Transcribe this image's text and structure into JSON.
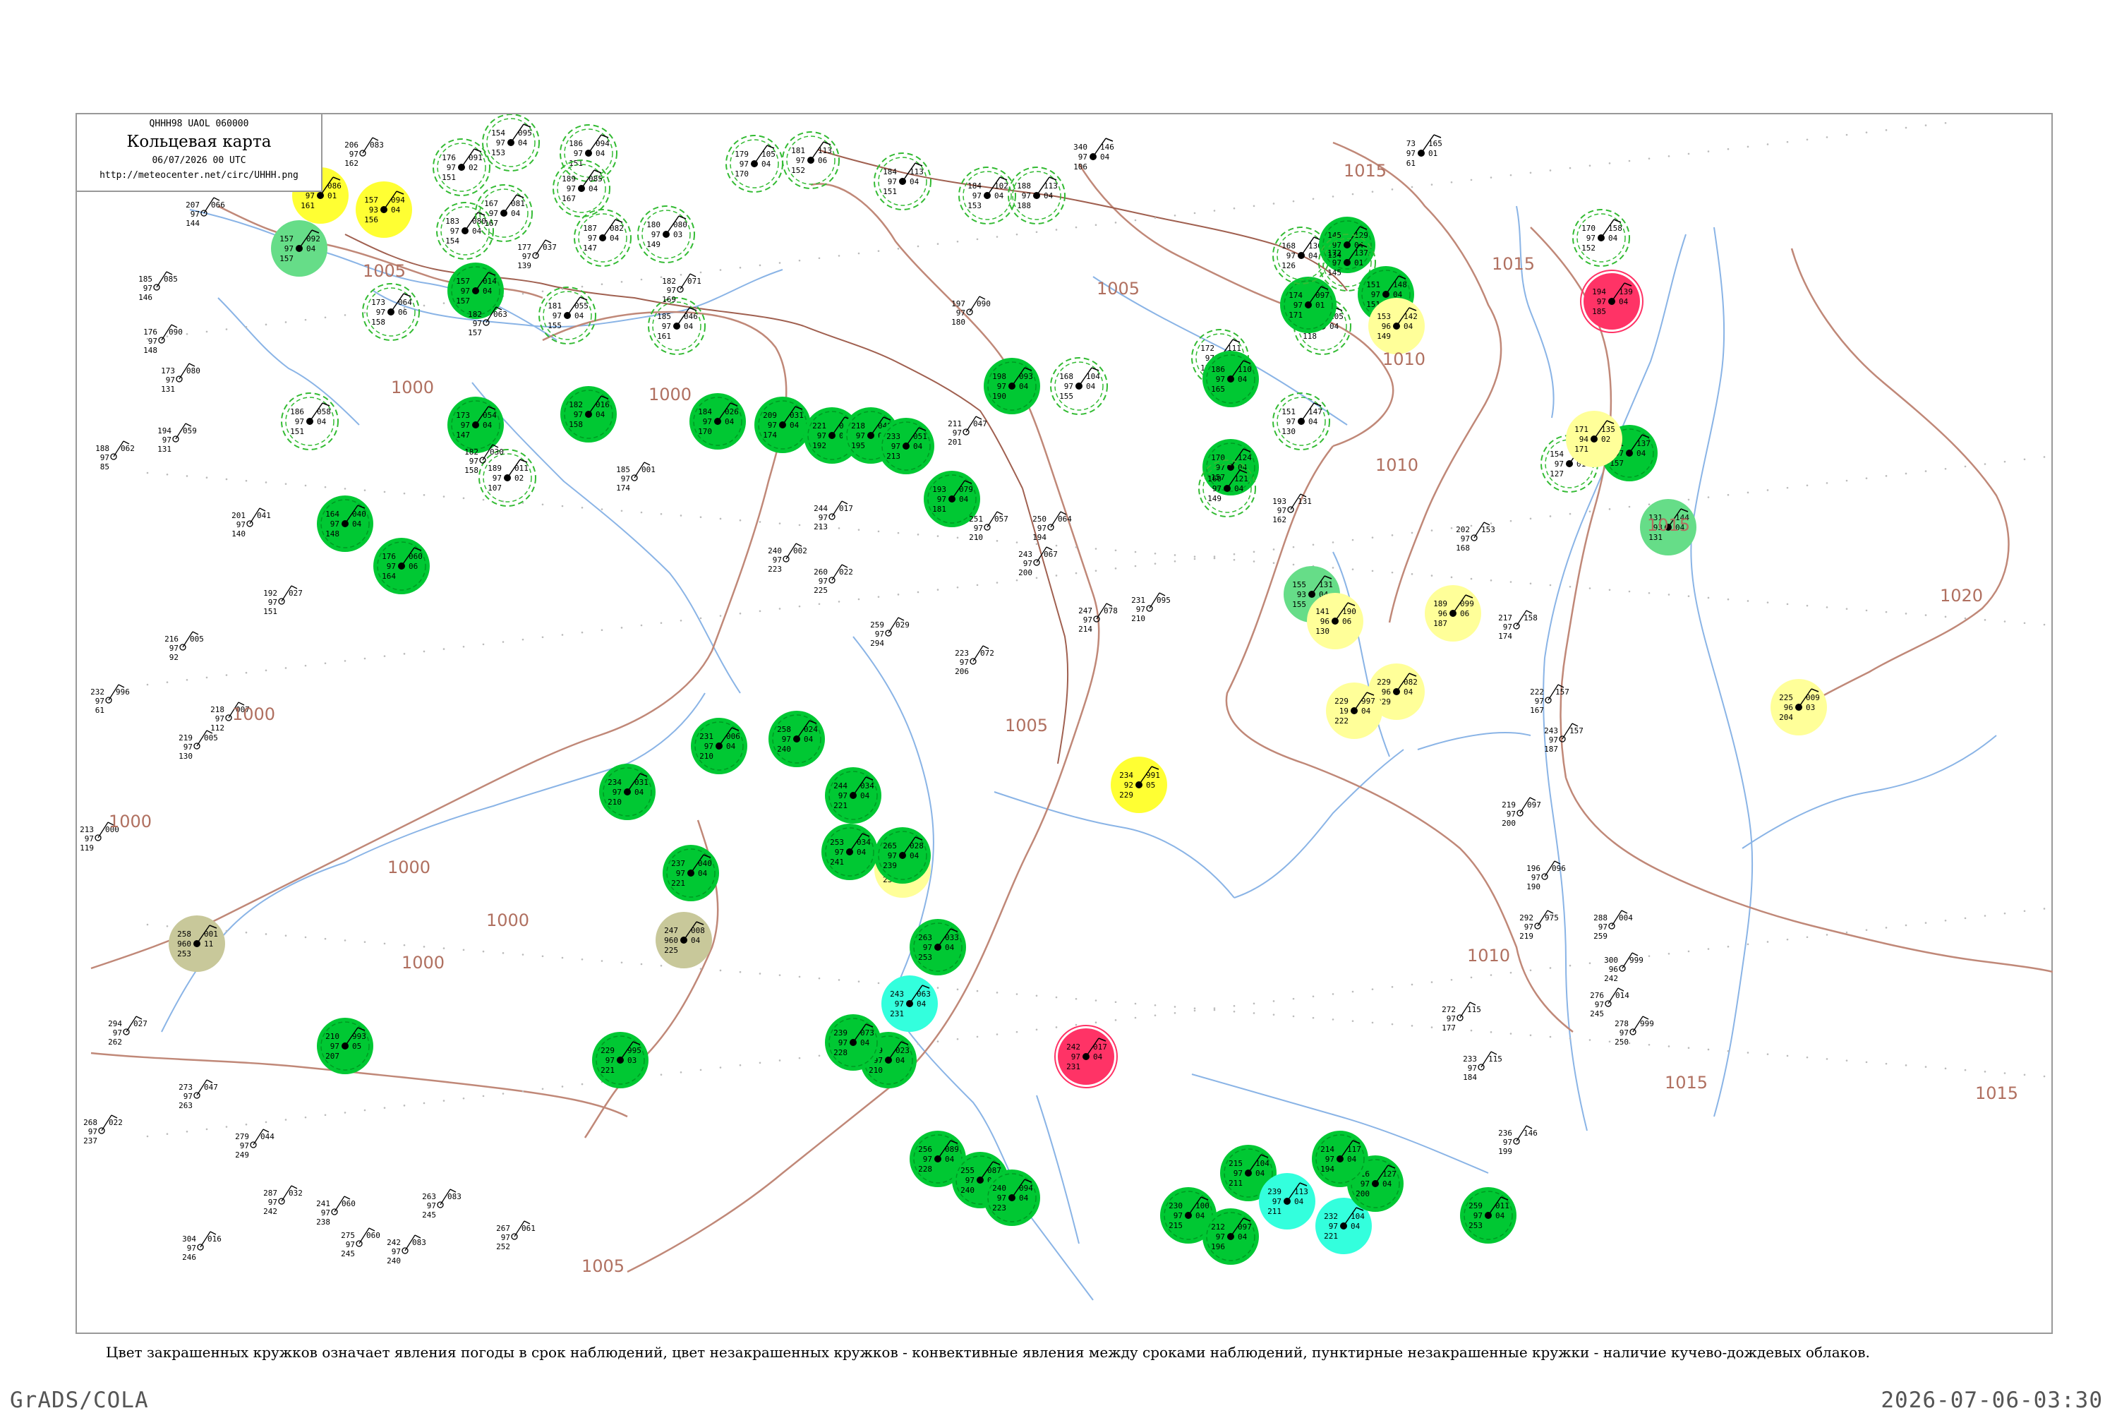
{
  "header": {
    "code_line": "QHHH98  UAOL  060000",
    "title": "Кольцевая карта",
    "datetime": "06/07/2026 00 UTC",
    "url": "http://meteocenter.net/circ/UHHH.png"
  },
  "legend_caption": "Цвет закрашенных кружков означает явления погоды в срок наблюдений, цвет незакрашенных кружков - конвективные явления между сроками наблюдений, пунктирные незакрашенные кружки - наличие кучево-дождевых облаков.",
  "footer": {
    "left": "GrADS/COLA",
    "right": "2026-07-06-03:30"
  },
  "colors": {
    "green": "#00c833",
    "light_green": "#66dd88",
    "yellow": "#ffff33",
    "pale_yellow": "#ffff99",
    "red": "#ff3366",
    "olive": "#c8c89a",
    "cyan": "#33ffdd",
    "dashed_ring": "#33bb33",
    "river": "#8ab4e6",
    "isobar": "#c08878",
    "border": "#a06050"
  },
  "isobar_labels": [
    "1000",
    "1005",
    "1010",
    "1015",
    "1020"
  ],
  "stations": [
    {
      "p": "161",
      "dp": "086",
      "t": "97",
      "v": "01",
      "tail": "161",
      "idx": "",
      "fill": "yellow"
    },
    {
      "p": "157",
      "dp": "094",
      "t": "93",
      "v": "04",
      "tail": "156",
      "idx": "",
      "fill": "yellow"
    },
    {
      "p": "157",
      "dp": "092",
      "t": "97",
      "v": "04",
      "tail": "157",
      "idx": "",
      "fill": "light_green"
    },
    {
      "p": "154",
      "dp": "095",
      "t": "97",
      "v": "04",
      "tail": "153",
      "idx": "",
      "fill": "ring"
    },
    {
      "p": "176",
      "dp": "091",
      "t": "97",
      "v": "02",
      "tail": "151",
      "idx": "",
      "fill": "ring"
    },
    {
      "p": "186",
      "dp": "094",
      "t": "97",
      "v": "04",
      "tail": "151",
      "idx": "",
      "fill": "ring"
    },
    {
      "p": "179",
      "dp": "105",
      "t": "97",
      "v": "04",
      "tail": "170",
      "idx": "",
      "fill": "ring"
    },
    {
      "p": "181",
      "dp": "113",
      "t": "97",
      "v": "06",
      "tail": "152",
      "idx": "",
      "fill": "ring"
    },
    {
      "p": "184",
      "dp": "113",
      "t": "97",
      "v": "04",
      "tail": "151",
      "idx": "",
      "fill": "ring"
    },
    {
      "p": "184",
      "dp": "102",
      "t": "97",
      "v": "04",
      "tail": "153",
      "idx": "",
      "fill": "ring"
    },
    {
      "p": "188",
      "dp": "113",
      "t": "97",
      "v": "04",
      "tail": "188",
      "idx": "",
      "fill": "ring"
    },
    {
      "p": "340",
      "dp": "146",
      "t": "97",
      "v": "04",
      "tail": "106",
      "idx": "",
      "fill": "none"
    },
    {
      "p": "73",
      "dp": "165",
      "t": "97",
      "v": "01",
      "tail": "61",
      "idx": "",
      "fill": "none"
    },
    {
      "p": "173",
      "dp": "064",
      "t": "97",
      "v": "06",
      "tail": "158",
      "idx": "",
      "fill": "ring"
    },
    {
      "p": "157",
      "dp": "014",
      "t": "97",
      "v": "04",
      "tail": "157",
      "idx": "",
      "fill": "green"
    },
    {
      "p": "183",
      "dp": "080",
      "t": "97",
      "v": "04",
      "tail": "154",
      "idx": "",
      "fill": "ring"
    },
    {
      "p": "189",
      "dp": "085",
      "t": "97",
      "v": "04",
      "tail": "167",
      "idx": "",
      "fill": "ring"
    },
    {
      "p": "167",
      "dp": "081",
      "t": "97",
      "v": "04",
      "tail": "167",
      "idx": "",
      "fill": "ring"
    },
    {
      "p": "187",
      "dp": "082",
      "t": "97",
      "v": "04",
      "tail": "147",
      "idx": "",
      "fill": "ring"
    },
    {
      "p": "180",
      "dp": "080",
      "t": "97",
      "v": "03",
      "tail": "149",
      "idx": "",
      "fill": "ring"
    },
    {
      "p": "185",
      "dp": "046",
      "t": "97",
      "v": "04",
      "tail": "161",
      "idx": "",
      "fill": "ring"
    },
    {
      "p": "181",
      "dp": "055",
      "t": "97",
      "v": "04",
      "tail": "155",
      "idx": "",
      "fill": "ring"
    },
    {
      "p": "186",
      "dp": "058",
      "t": "97",
      "v": "04",
      "tail": "151",
      "idx": "",
      "fill": "ring"
    },
    {
      "p": "173",
      "dp": "054",
      "t": "97",
      "v": "04",
      "tail": "147",
      "idx": "",
      "fill": "green"
    },
    {
      "p": "189",
      "dp": "011",
      "t": "97",
      "v": "02",
      "tail": "107",
      "idx": "",
      "fill": "ring"
    },
    {
      "p": "164",
      "dp": "040",
      "t": "97",
      "v": "04",
      "tail": "148",
      "idx": "",
      "fill": "green"
    },
    {
      "p": "176",
      "dp": "060",
      "t": "97",
      "v": "06",
      "tail": "164",
      "idx": "",
      "fill": "green"
    },
    {
      "p": "182",
      "dp": "016",
      "t": "97",
      "v": "04",
      "tail": "158",
      "idx": "",
      "fill": "green"
    },
    {
      "p": "184",
      "dp": "026",
      "t": "97",
      "v": "04",
      "tail": "170",
      "idx": "",
      "fill": "green"
    },
    {
      "p": "209",
      "dp": "031",
      "t": "97",
      "v": "04",
      "tail": "174",
      "idx": "",
      "fill": "green"
    },
    {
      "p": "221",
      "dp": "040",
      "t": "97",
      "v": "04",
      "tail": "192",
      "idx": "",
      "fill": "green"
    },
    {
      "p": "218",
      "dp": "049",
      "t": "97",
      "v": "04",
      "tail": "195",
      "idx": "",
      "fill": "green"
    },
    {
      "p": "233",
      "dp": "051",
      "t": "97",
      "v": "04",
      "tail": "213",
      "idx": "",
      "fill": "green"
    },
    {
      "p": "193",
      "dp": "079",
      "t": "97",
      "v": "04",
      "tail": "181",
      "idx": "",
      "fill": "green"
    },
    {
      "p": "198",
      "dp": "093",
      "t": "97",
      "v": "04",
      "tail": "190",
      "idx": "",
      "fill": "green"
    },
    {
      "p": "168",
      "dp": "104",
      "t": "97",
      "v": "04",
      "tail": "155",
      "idx": "",
      "fill": "ring"
    },
    {
      "p": "172",
      "dp": "111",
      "t": "97",
      "v": "01",
      "tail": "152",
      "idx": "",
      "fill": "ring"
    },
    {
      "p": "186",
      "dp": "110",
      "t": "97",
      "v": "04",
      "tail": "165",
      "idx": "",
      "fill": "green"
    },
    {
      "p": "170",
      "dp": "124",
      "t": "97",
      "v": "04",
      "tail": "157",
      "idx": "",
      "fill": "green"
    },
    {
      "p": "160",
      "dp": "121",
      "t": "97",
      "v": "04",
      "tail": "149",
      "idx": "",
      "fill": "ring"
    },
    {
      "p": "151",
      "dp": "147",
      "t": "97",
      "v": "04",
      "tail": "130",
      "idx": "",
      "fill": "ring"
    },
    {
      "p": "124",
      "dp": "105",
      "t": "97",
      "v": "04",
      "tail": "118",
      "idx": "",
      "fill": "ring"
    },
    {
      "p": "174",
      "dp": "097",
      "t": "97",
      "v": "01",
      "tail": "171",
      "idx": "",
      "fill": "green"
    },
    {
      "p": "168",
      "dp": "130",
      "t": "97",
      "v": "04",
      "tail": "126",
      "idx": "",
      "fill": "ring"
    },
    {
      "p": "145",
      "dp": "129",
      "t": "97",
      "v": "04",
      "tail": "134",
      "idx": "",
      "fill": "green"
    },
    {
      "p": "172",
      "dp": "137",
      "t": "97",
      "v": "01",
      "tail": "145",
      "idx": "",
      "fill": "ring"
    },
    {
      "p": "151",
      "dp": "148",
      "t": "97",
      "v": "04",
      "tail": "151",
      "idx": "",
      "fill": "green"
    },
    {
      "p": "153",
      "dp": "142",
      "t": "96",
      "v": "04",
      "tail": "149",
      "idx": "",
      "fill": "pale_yellow"
    },
    {
      "p": "154",
      "dp": "160",
      "t": "97",
      "v": "01",
      "tail": "127",
      "idx": "",
      "fill": "ring"
    },
    {
      "p": "170",
      "dp": "158",
      "t": "97",
      "v": "04",
      "tail": "152",
      "idx": "",
      "fill": "ring"
    },
    {
      "p": "194",
      "dp": "139",
      "t": "97",
      "v": "04",
      "tail": "185",
      "idx": "",
      "fill": "red"
    },
    {
      "p": "181",
      "dp": "137",
      "t": "97",
      "v": "04",
      "tail": "157",
      "idx": "",
      "fill": "green"
    },
    {
      "p": "131",
      "dp": "144",
      "t": "93",
      "v": "04",
      "tail": "131",
      "idx": "",
      "fill": "light_green"
    },
    {
      "p": "171",
      "dp": "135",
      "t": "94",
      "v": "02",
      "tail": "171",
      "idx": "",
      "fill": "pale_yellow"
    },
    {
      "p": "155",
      "dp": "131",
      "t": "93",
      "v": "04",
      "tail": "155",
      "idx": "",
      "fill": "light_green"
    },
    {
      "p": "141",
      "dp": "190",
      "t": "96",
      "v": "06",
      "tail": "130",
      "idx": "",
      "fill": "pale_yellow"
    },
    {
      "p": "189",
      "dp": "099",
      "t": "96",
      "v": "06",
      "tail": "187",
      "idx": "",
      "fill": "pale_yellow"
    },
    {
      "p": "229",
      "dp": "082",
      "t": "96",
      "v": "04",
      "tail": "229",
      "idx": "",
      "fill": "pale_yellow"
    },
    {
      "p": "229",
      "dp": "997",
      "t": "19",
      "v": "04",
      "tail": "222",
      "idx": "",
      "fill": "pale_yellow"
    },
    {
      "p": "225",
      "dp": "009",
      "t": "96",
      "v": "03",
      "tail": "204",
      "idx": "",
      "fill": "pale_yellow"
    },
    {
      "p": "234",
      "dp": "991",
      "t": "92",
      "v": "05",
      "tail": "229",
      "idx": "",
      "fill": "yellow"
    },
    {
      "p": "244",
      "dp": "061",
      "t": "96",
      "v": "04",
      "tail": "236",
      "idx": "",
      "fill": "pale_yellow"
    },
    {
      "p": "247",
      "dp": "008",
      "t": "960",
      "v": "04",
      "tail": "225",
      "idx": "",
      "fill": "olive"
    },
    {
      "p": "258",
      "dp": "001",
      "t": "960",
      "v": "11",
      "tail": "253",
      "idx": "",
      "fill": "olive"
    },
    {
      "p": "242",
      "dp": "017",
      "t": "97",
      "v": "04",
      "tail": "231",
      "idx": "",
      "fill": "red"
    },
    {
      "p": "210",
      "dp": "993",
      "t": "97",
      "v": "05",
      "tail": "207",
      "idx": "",
      "fill": "green"
    },
    {
      "p": "229",
      "dp": "995",
      "t": "97",
      "v": "03",
      "tail": "221",
      "idx": "",
      "fill": "green"
    },
    {
      "p": "229",
      "dp": "023",
      "t": "97",
      "v": "04",
      "tail": "210",
      "idx": "",
      "fill": "green"
    },
    {
      "p": "234",
      "dp": "031",
      "t": "97",
      "v": "04",
      "tail": "210",
      "idx": "",
      "fill": "green"
    },
    {
      "p": "237",
      "dp": "040",
      "t": "97",
      "v": "04",
      "tail": "221",
      "idx": "",
      "fill": "green"
    },
    {
      "p": "231",
      "dp": "006",
      "t": "97",
      "v": "04",
      "tail": "210",
      "idx": "",
      "fill": "green"
    },
    {
      "p": "244",
      "dp": "034",
      "t": "97",
      "v": "04",
      "tail": "221",
      "idx": "",
      "fill": "green"
    },
    {
      "p": "253",
      "dp": "034",
      "t": "97",
      "v": "04",
      "tail": "241",
      "idx": "",
      "fill": "green"
    },
    {
      "p": "258",
      "dp": "024",
      "t": "97",
      "v": "04",
      "tail": "240",
      "idx": "",
      "fill": "green"
    },
    {
      "p": "265",
      "dp": "028",
      "t": "97",
      "v": "04",
      "tail": "239",
      "idx": "",
      "fill": "green"
    },
    {
      "p": "263",
      "dp": "033",
      "t": "97",
      "v": "04",
      "tail": "253",
      "idx": "",
      "fill": "green"
    },
    {
      "p": "243",
      "dp": "063",
      "t": "97",
      "v": "04",
      "tail": "231",
      "idx": "",
      "fill": "cyan"
    },
    {
      "p": "239",
      "dp": "073",
      "t": "97",
      "v": "04",
      "tail": "228",
      "idx": "",
      "fill": "green"
    },
    {
      "p": "256",
      "dp": "089",
      "t": "97",
      "v": "04",
      "tail": "228",
      "idx": "",
      "fill": "green"
    },
    {
      "p": "255",
      "dp": "087",
      "t": "97",
      "v": "04",
      "tail": "240",
      "idx": "",
      "fill": "green"
    },
    {
      "p": "240",
      "dp": "094",
      "t": "97",
      "v": "04",
      "tail": "223",
      "idx": "",
      "fill": "green"
    },
    {
      "p": "230",
      "dp": "100",
      "t": "97",
      "v": "04",
      "tail": "215",
      "idx": "",
      "fill": "green"
    },
    {
      "p": "212",
      "dp": "097",
      "t": "97",
      "v": "04",
      "tail": "196",
      "idx": "",
      "fill": "green"
    },
    {
      "p": "215",
      "dp": "104",
      "t": "97",
      "v": "04",
      "tail": "211",
      "idx": "",
      "fill": "green"
    },
    {
      "p": "239",
      "dp": "113",
      "t": "97",
      "v": "04",
      "tail": "211",
      "idx": "",
      "fill": "cyan"
    },
    {
      "p": "232",
      "dp": "104",
      "t": "97",
      "v": "04",
      "tail": "221",
      "idx": "",
      "fill": "cyan"
    },
    {
      "p": "216",
      "dp": "127",
      "t": "97",
      "v": "04",
      "tail": "200",
      "idx": "",
      "fill": "green"
    },
    {
      "p": "214",
      "dp": "117",
      "t": "97",
      "v": "04",
      "tail": "194",
      "idx": "",
      "fill": "green"
    },
    {
      "p": "259",
      "dp": "011",
      "t": "97",
      "v": "04",
      "tail": "253",
      "idx": "",
      "fill": "green"
    }
  ],
  "plain_stations": [
    {
      "p": "206",
      "dp": "083",
      "t": "97",
      "v": "162"
    },
    {
      "p": "207",
      "dp": "066",
      "t": "97",
      "v": "144"
    },
    {
      "p": "185",
      "dp": "085",
      "t": "97",
      "v": "146"
    },
    {
      "p": "176",
      "dp": "090",
      "t": "97",
      "v": "148"
    },
    {
      "p": "173",
      "dp": "080",
      "t": "97",
      "v": "131"
    },
    {
      "p": "188",
      "dp": "062",
      "t": "97",
      "v": "85"
    },
    {
      "p": "194",
      "dp": "059",
      "t": "97",
      "v": "131"
    },
    {
      "p": "201",
      "dp": "041",
      "t": "97",
      "v": "140"
    },
    {
      "p": "192",
      "dp": "027",
      "t": "97",
      "v": "151"
    },
    {
      "p": "216",
      "dp": "005",
      "t": "97",
      "v": "92"
    },
    {
      "p": "232",
      "dp": "996",
      "t": "97",
      "v": "61"
    },
    {
      "p": "218",
      "dp": "007",
      "t": "97",
      "v": "112"
    },
    {
      "p": "219",
      "dp": "005",
      "t": "97",
      "v": "130"
    },
    {
      "p": "213",
      "dp": "000",
      "t": "97",
      "v": "119"
    },
    {
      "p": "177",
      "dp": "037",
      "t": "97",
      "v": "139"
    },
    {
      "p": "182",
      "dp": "063",
      "t": "97",
      "v": "157"
    },
    {
      "p": "182",
      "dp": "030",
      "t": "97",
      "v": "158"
    },
    {
      "p": "185",
      "dp": "001",
      "t": "97",
      "v": "174"
    },
    {
      "p": "182",
      "dp": "071",
      "t": "97",
      "v": "169"
    },
    {
      "p": "197",
      "dp": "090",
      "t": "97",
      "v": "180"
    },
    {
      "p": "244",
      "dp": "017",
      "t": "97",
      "v": "213"
    },
    {
      "p": "240",
      "dp": "002",
      "t": "97",
      "v": "223"
    },
    {
      "p": "260",
      "dp": "022",
      "t": "97",
      "v": "225"
    },
    {
      "p": "259",
      "dp": "029",
      "t": "97",
      "v": "294"
    },
    {
      "p": "211",
      "dp": "047",
      "t": "97",
      "v": "201"
    },
    {
      "p": "251",
      "dp": "057",
      "t": "97",
      "v": "210"
    },
    {
      "p": "250",
      "dp": "064",
      "t": "97",
      "v": "194"
    },
    {
      "p": "243",
      "dp": "067",
      "t": "97",
      "v": "200"
    },
    {
      "p": "223",
      "dp": "072",
      "t": "97",
      "v": "206"
    },
    {
      "p": "247",
      "dp": "078",
      "t": "97",
      "v": "214"
    },
    {
      "p": "231",
      "dp": "095",
      "t": "97",
      "v": "210"
    },
    {
      "p": "193",
      "dp": "131",
      "t": "97",
      "v": "162"
    },
    {
      "p": "202",
      "dp": "153",
      "t": "97",
      "v": "168"
    },
    {
      "p": "217",
      "dp": "158",
      "t": "97",
      "v": "174"
    },
    {
      "p": "222",
      "dp": "157",
      "t": "97",
      "v": "167"
    },
    {
      "p": "243",
      "dp": "157",
      "t": "97",
      "v": "187"
    },
    {
      "p": "219",
      "dp": "097",
      "t": "97",
      "v": "200"
    },
    {
      "p": "196",
      "dp": "096",
      "t": "97",
      "v": "190"
    },
    {
      "p": "272",
      "dp": "115",
      "t": "97",
      "v": "177"
    },
    {
      "p": "233",
      "dp": "115",
      "t": "97",
      "v": "184"
    },
    {
      "p": "236",
      "dp": "146",
      "t": "97",
      "v": "199"
    },
    {
      "p": "276",
      "dp": "014",
      "t": "97",
      "v": "245"
    },
    {
      "p": "278",
      "dp": "999",
      "t": "97",
      "v": "250"
    },
    {
      "p": "292",
      "dp": "975",
      "t": "97",
      "v": "219"
    },
    {
      "p": "288",
      "dp": "004",
      "t": "97",
      "v": "259"
    },
    {
      "p": "300",
      "dp": "999",
      "t": "96",
      "v": "242"
    },
    {
      "p": "304",
      "dp": "016",
      "t": "97",
      "v": "246"
    },
    {
      "p": "268",
      "dp": "022",
      "t": "97",
      "v": "237"
    },
    {
      "p": "294",
      "dp": "027",
      "t": "97",
      "v": "262"
    },
    {
      "p": "273",
      "dp": "047",
      "t": "97",
      "v": "263"
    },
    {
      "p": "279",
      "dp": "044",
      "t": "97",
      "v": "249"
    },
    {
      "p": "287",
      "dp": "032",
      "t": "97",
      "v": "242"
    },
    {
      "p": "241",
      "dp": "060",
      "t": "97",
      "v": "238"
    },
    {
      "p": "275",
      "dp": "060",
      "t": "97",
      "v": "245"
    },
    {
      "p": "242",
      "dp": "083",
      "t": "97",
      "v": "240"
    },
    {
      "p": "263",
      "dp": "083",
      "t": "97",
      "v": "245"
    },
    {
      "p": "267",
      "dp": "061",
      "t": "97",
      "v": "252"
    }
  ]
}
